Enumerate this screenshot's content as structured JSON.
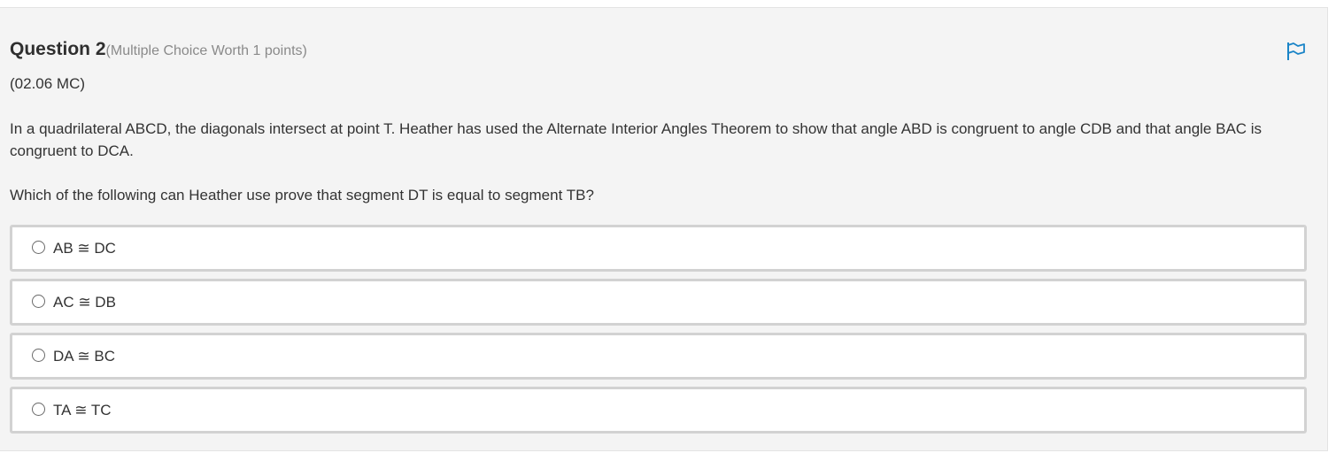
{
  "question": {
    "title": "Question 2",
    "meta": "(Multiple Choice Worth 1 points)",
    "code": "(02.06 MC)",
    "prompt": "In a quadrilateral ABCD, the diagonals intersect at point T. Heather has used the Alternate Interior Angles Theorem to show that angle ABD is congruent to angle CDB and that angle BAC is congruent to DCA.",
    "ask": "Which of the following can Heather use prove that segment DT is equal to segment TB?",
    "flag_icon": "flag-icon",
    "accent_color": "#1a84c7"
  },
  "options": [
    {
      "label": "AB ≅ DC"
    },
    {
      "label": "AC ≅ DB"
    },
    {
      "label": "DA ≅ BC"
    },
    {
      "label": "TA ≅ TC"
    }
  ]
}
